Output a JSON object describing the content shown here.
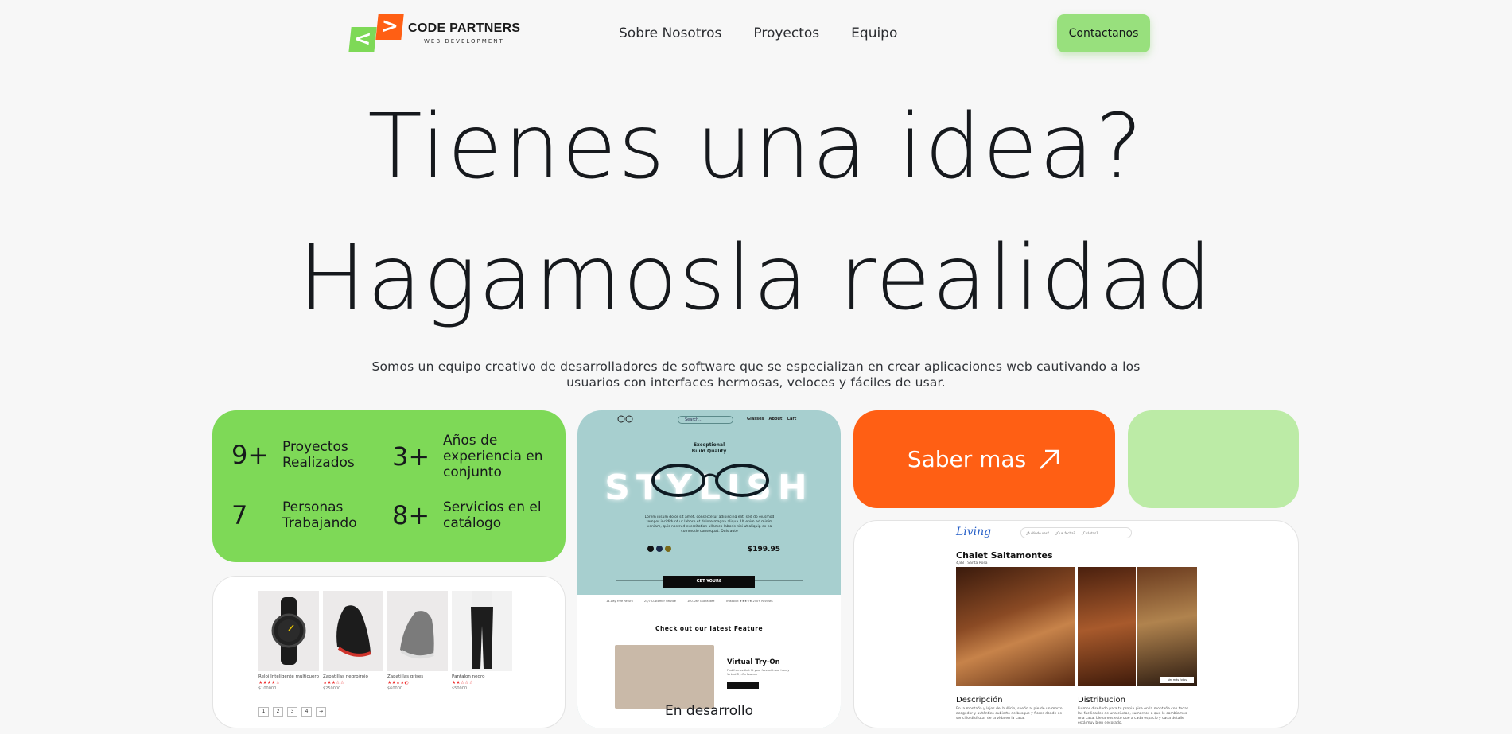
{
  "brand": {
    "left_glyph": "<",
    "right_glyph": ">",
    "name": "CODE PARTNERS",
    "tagline": "WEB DEVELOPMENT"
  },
  "nav": {
    "links": [
      "Sobre Nosotros",
      "Proyectos",
      "Equipo"
    ],
    "cta": "Contactanos"
  },
  "hero": {
    "line1": "Tienes una idea?",
    "line2": "Hagamosla realidad",
    "subtitle": "Somos un equipo creativo de desarrolladores de software que se especializan en crear aplicaciones web cautivando a los usuarios con interfaces hermosas, veloces y fáciles de usar."
  },
  "stats": [
    {
      "value": "9+",
      "label": "Proyectos Realizados"
    },
    {
      "value": "3+",
      "label": "Años de experiencia en conjunto"
    },
    {
      "value": "7",
      "label": "Personas Trabajando"
    },
    {
      "value": "8+",
      "label": "Servicios en el catálogo"
    }
  ],
  "saber_mas": {
    "label": "Saber mas",
    "icon": "arrow-up-right-icon"
  },
  "shop_preview": {
    "products": [
      {
        "name": "Reloj Inteligente multicuero",
        "stars": "★★★★☆",
        "price": "$100000"
      },
      {
        "name": "Zapatillas negro/rojo",
        "stars": "★★★☆☆",
        "price": "$250000"
      },
      {
        "name": "Zapatillas grises",
        "stars": "★★★★◐",
        "price": "$60000"
      },
      {
        "name": "Pantalon negro",
        "stars": "★★☆☆☆",
        "price": "$50000"
      }
    ],
    "pages": [
      "1",
      "2",
      "3",
      "4",
      "→"
    ]
  },
  "glasses_preview": {
    "nav": [
      "Glasses",
      "About",
      "Cart"
    ],
    "search_placeholder": "Search...",
    "tagline_1": "Exceptional",
    "tagline_2": "Build Quality",
    "hero_word": "STYLISH",
    "body": "Lorem ipsum dolor sit amet, consectetur adipiscing elit, sed do eiusmod tempor incididunt ut labore et dolore magna aliqua. Ut enim ad minim veniam, quis nostrud exercitation ullamco laboris nisi ut aliquip ex ea commodo consequat. Duis aute",
    "price": "$199.95",
    "cta": "GET YOURS",
    "features": [
      "14-Day Free Return",
      "24/7 Customer Service",
      "100-Day Guarantee",
      "Trustpilot ★★★★★ 250+ Reviews"
    ],
    "latest_title": "Check out our latest Feature",
    "feature_name": "Virtual Try-On",
    "feature_text": "Find frames that fit your face with our handy Virtual Try-On Feature",
    "status": "En desarrollo",
    "colors": {
      "swatch1": "#111111",
      "swatch2": "#1b2a4a",
      "swatch3": "#7a6a1a"
    }
  },
  "chalet_preview": {
    "logo": "Living",
    "search_placeholder": "¿A dónde vas?",
    "filter1": "¿Qué fecha?",
    "filter2": "¿Cuántos?",
    "title": "Chalet Saltamontes",
    "meta": "4,88 · Santa Rosa",
    "photos_button": "Ver más fotos",
    "sections": [
      {
        "title": "Descripción",
        "text": "En la montaña y lejos del bullicio, sueño al pie de un morro: acogedor y auténtico cubierto de bosque y flores donde es sencillo disfrutar de la vida en la casa."
      },
      {
        "title": "Distribucion",
        "text": "Fuimos diseñado para tu propia pisa en la montaña con todas las facilidades de una ciudad, sumarnos a que le cambiamos una casa. Llevamos esto que a cada espacio y cada detalle está muy bien decorado."
      }
    ]
  },
  "colors": {
    "green": "#7ed957",
    "orange": "#ff5f14",
    "mint": "#bceba6",
    "cta_green": "#98e07d",
    "text": "#17191c"
  }
}
